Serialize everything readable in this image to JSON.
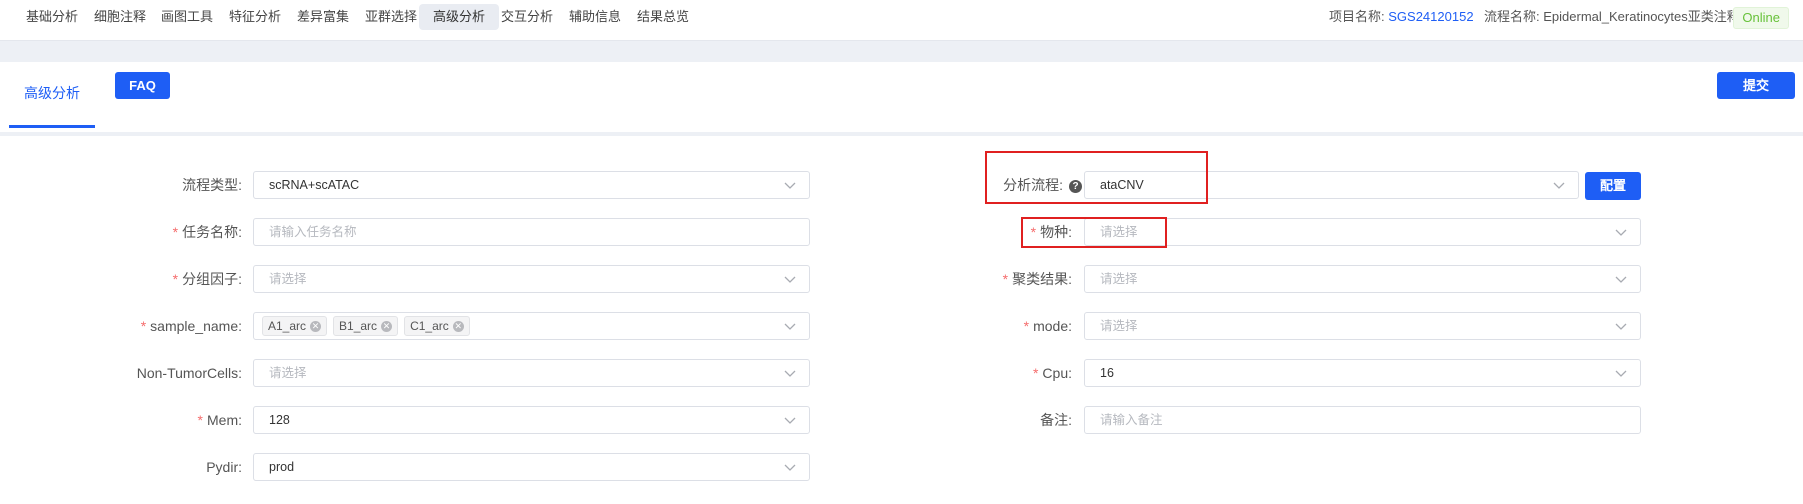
{
  "nav": {
    "items": [
      "基础分析",
      "细胞注释",
      "画图工具",
      "特征分析",
      "差异富集",
      "亚群选择",
      "高级分析",
      "交互分析",
      "辅助信息",
      "结果总览"
    ],
    "active": "高级分析"
  },
  "project": {
    "name_label": "项目名称:",
    "name_value": "SGS24120152",
    "flow_label": "流程名称:",
    "flow_value": "Epidermal_Keratinocytes亚类注释",
    "status": "Online"
  },
  "tabs": {
    "active_label": "高级分析",
    "faq_label": "FAQ",
    "submit_label": "提交"
  },
  "form": {
    "left": [
      {
        "label": "流程类型:",
        "required": false,
        "value": "scRNA+scATAC",
        "placeholder": "",
        "type": "select"
      },
      {
        "label": "任务名称:",
        "required": true,
        "value": "",
        "placeholder": "请输入任务名称",
        "type": "input"
      },
      {
        "label": "分组因子:",
        "required": true,
        "value": "",
        "placeholder": "请选择",
        "type": "select"
      },
      {
        "label": "sample_name:",
        "required": true,
        "value": "",
        "placeholder": "",
        "type": "multi",
        "tags": [
          "A1_arc",
          "B1_arc",
          "C1_arc"
        ]
      },
      {
        "label": "Non-TumorCells:",
        "required": false,
        "value": "",
        "placeholder": "请选择",
        "type": "select"
      },
      {
        "label": "Mem:",
        "required": true,
        "value": "128",
        "placeholder": "",
        "type": "select"
      },
      {
        "label": "Pydir:",
        "required": false,
        "value": "prod",
        "placeholder": "",
        "type": "select"
      }
    ],
    "right": [
      {
        "label": "分析流程:",
        "required": false,
        "value": "ataCNV",
        "placeholder": "",
        "type": "select",
        "help": "?"
      },
      {
        "label": "物种:",
        "required": true,
        "value": "",
        "placeholder": "请选择",
        "type": "select"
      },
      {
        "label": "聚类结果:",
        "required": true,
        "value": "",
        "placeholder": "请选择",
        "type": "select"
      },
      {
        "label": "mode:",
        "required": true,
        "value": "",
        "placeholder": "请选择",
        "type": "select"
      },
      {
        "label": "Cpu:",
        "required": true,
        "value": "16",
        "placeholder": "",
        "type": "select"
      },
      {
        "label": "备注:",
        "required": false,
        "value": "",
        "placeholder": "请输入备注",
        "type": "input"
      }
    ],
    "config_label": "配置"
  },
  "colors": {
    "primary": "#1e5ef5",
    "required": "#f56c6c",
    "highlight": "#e02020",
    "online": "#67c23a"
  }
}
